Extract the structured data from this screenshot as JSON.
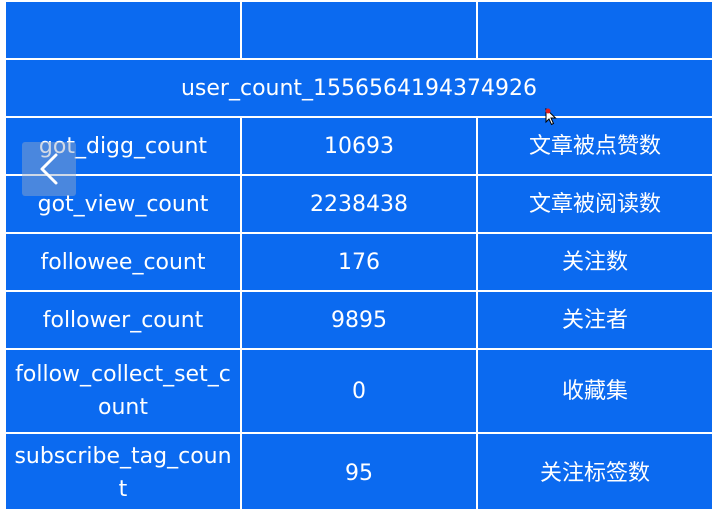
{
  "table": {
    "title": "user_count_1556564194374926",
    "rows": [
      {
        "field": "got_digg_count",
        "value": "10693",
        "desc": "文章被点赞数"
      },
      {
        "field": "got_view_count",
        "value": "2238438",
        "desc": "文章被阅读数"
      },
      {
        "field": "followee_count",
        "value": "176",
        "desc": "关注数"
      },
      {
        "field": "follower_count",
        "value": "9895",
        "desc": "关注者"
      },
      {
        "field": "follow_collect_set_count",
        "value": "0",
        "desc": "收藏集"
      },
      {
        "field": "subscribe_tag_count",
        "value": "95",
        "desc": "关注标签数"
      }
    ]
  },
  "overlay": {
    "back_icon": "chevron-left-icon",
    "cursor_icon": "mouse-pointer-icon"
  },
  "colors": {
    "table_bg": "#0b6af0",
    "grid": "#ffffff",
    "text": "#ffffff"
  }
}
